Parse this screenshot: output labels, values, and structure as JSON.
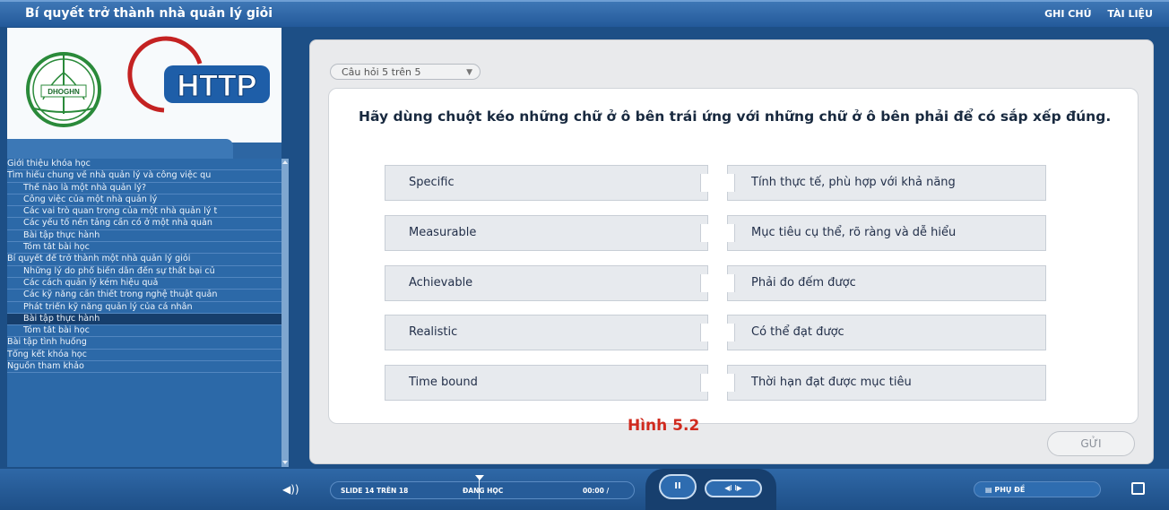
{
  "window": {
    "title": "Bí quyết trở thành nhà quản lý giỏi",
    "links": [
      "GHI CHÚ",
      "TÀI LIỆU"
    ]
  },
  "logo": {
    "left_text": "DHOGHN",
    "right_text": "HTTP"
  },
  "sidebar": {
    "toc": [
      {
        "label": "Giới thiệu khóa học",
        "level": 1,
        "active": false
      },
      {
        "label": "Tìm hiểu chung về nhà quản lý và công việc qu",
        "level": 1,
        "active": false
      },
      {
        "label": "Thế nào là một nhà quản lý?",
        "level": 2,
        "active": false
      },
      {
        "label": "Công việc của một nhà quản lý",
        "level": 2,
        "active": false
      },
      {
        "label": "Các vai trò quan trọng của một nhà quản lý t",
        "level": 2,
        "active": false
      },
      {
        "label": "Các yếu tố nền tảng cần có ở một nhà quản",
        "level": 2,
        "active": false
      },
      {
        "label": "Bài tập thực hành",
        "level": 2,
        "active": false
      },
      {
        "label": "Tóm tắt bài học",
        "level": 2,
        "active": false
      },
      {
        "label": "Bí quyết để trở thành một nhà quản lý giỏi",
        "level": 1,
        "active": false
      },
      {
        "label": "Những lý do phổ biến dẫn đến sự thất bại củ",
        "level": 2,
        "active": false
      },
      {
        "label": "Các cách quản lý kém hiệu quả",
        "level": 2,
        "active": false
      },
      {
        "label": "Các kỹ năng cần thiết trong nghệ thuật quản",
        "level": 2,
        "active": false
      },
      {
        "label": "Phát triển kỹ năng quản lý của cá nhân",
        "level": 2,
        "active": false
      },
      {
        "label": "Bài tập thực hành",
        "level": 2,
        "active": true
      },
      {
        "label": "Tóm tắt bài học",
        "level": 2,
        "active": false
      },
      {
        "label": "Bài tập tình huống",
        "level": 1,
        "active": false
      },
      {
        "label": "Tổng kết khóa học",
        "level": 1,
        "active": false
      },
      {
        "label": "Nguồn tham khảo",
        "level": 1,
        "active": false
      }
    ]
  },
  "quiz": {
    "question_select": "Câu hỏi 5 trên 5",
    "question": "Hãy dùng chuột kéo những chữ ở ô bên trái ứng với những chữ ở ô bên phải để có sắp xếp đúng.",
    "left_items": [
      "Specific",
      "Measurable",
      "Achievable",
      "Realistic",
      "Time bound"
    ],
    "right_items": [
      "Tính thực tế, phù hợp với khả năng",
      "Mục tiêu cụ thể, rõ ràng và dễ hiểu",
      "Phải đo đếm được",
      "Có thể đạt được",
      "Thời hạn đạt được mục tiêu"
    ],
    "caption": "Hình 5.2",
    "submit": "GỬI"
  },
  "player": {
    "slide_counter": "SLIDE 14 TRÊN 18",
    "status": "ĐANG HỌC",
    "time": "00:00 /",
    "pause_label": "II",
    "step_label": "◀I  I▶",
    "subtitles": "PHỤ ĐỀ",
    "volume_icon": "◀))",
    "fullscreen_icon": "[ ]"
  },
  "colors": {
    "accent_blue": "#2c69a8",
    "caption_red": "#d02a1e"
  }
}
